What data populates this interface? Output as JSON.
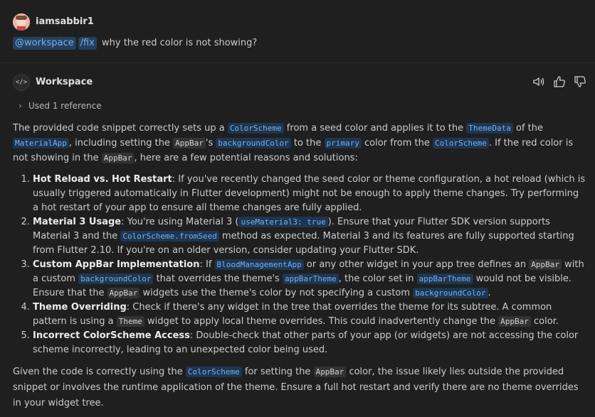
{
  "request": {
    "username": "iamsabbir1",
    "chips": [
      "@workspace",
      "/fix"
    ],
    "text": "why the red color is not showing?"
  },
  "response": {
    "agent_name": "Workspace",
    "agent_icon": "code-icon",
    "actions": [
      "read-aloud-icon",
      "thumbs-up-icon",
      "thumbs-down-icon"
    ],
    "reference_label": "Used 1 reference"
  },
  "colors": {
    "background": "#1f1f1f",
    "code_chip": "#6fb3f2",
    "text": "#cccccc"
  }
}
